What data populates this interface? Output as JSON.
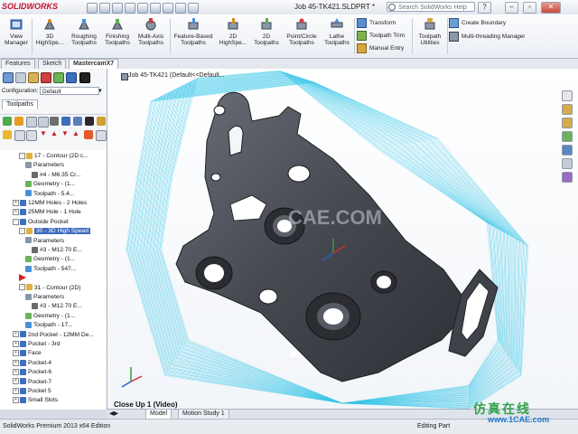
{
  "app": {
    "logo": "SOLIDWORKS",
    "document_title": "Job 45-TK421.SLDPRT *",
    "search_placeholder": "Search SolidWorks Help"
  },
  "command_manager": {
    "large_buttons": [
      {
        "label": "View\nManager",
        "icon": "view-manager-icon"
      },
      {
        "label": "3D\nHighSpe...",
        "icon": "3d-highspeed-icon"
      },
      {
        "label": "Roughing\nToolpaths",
        "icon": "roughing-toolpaths-icon"
      },
      {
        "label": "Finishing\nToolpaths",
        "icon": "finishing-toolpaths-icon"
      },
      {
        "label": "Multi-Axis\nToolpaths",
        "icon": "multi-axis-toolpaths-icon"
      },
      {
        "label": "Feature-Based\nToolpaths",
        "icon": "feature-based-toolpaths-icon"
      },
      {
        "label": "2D\nHighSpe...",
        "icon": "2d-highspeed-icon"
      },
      {
        "label": "2D\nToolpaths",
        "icon": "2d-toolpaths-icon"
      },
      {
        "label": "Point/Circle\nToolpaths",
        "icon": "point-circle-toolpaths-icon"
      },
      {
        "label": "Lathe\nToolpaths",
        "icon": "lathe-toolpaths-icon"
      }
    ],
    "small_buttons_col1": [
      "Transform",
      "Toolpath Trim",
      "Manual Entry"
    ],
    "utilities_label": "Toolpath\nUtilities",
    "small_buttons_col2": [
      "Create Boundary",
      "Multi-threading Manager"
    ]
  },
  "panel_tabs": [
    "Features",
    "Sketch",
    "MastercamX7"
  ],
  "left_panel": {
    "configuration_label": "Configuration:",
    "configuration_value": "Default",
    "toolpaths_tab": "Toolpaths",
    "tree": [
      {
        "indent": 3,
        "pm": "-",
        "icon": "folder",
        "text": "17 - Contour (2D c..."
      },
      {
        "indent": 4,
        "pm": "",
        "icon": "params",
        "text": "Parameters"
      },
      {
        "indent": 5,
        "pm": "",
        "icon": "tool",
        "text": "#4 - M6.35 Cr..."
      },
      {
        "indent": 4,
        "pm": "",
        "icon": "geometry",
        "text": "Geometry - (1..."
      },
      {
        "indent": 4,
        "pm": "",
        "icon": "toolpath",
        "text": "Toolpath - 5.4..."
      },
      {
        "indent": 2,
        "pm": "+",
        "icon": "op",
        "text": "12MM Holes - 2 Holes"
      },
      {
        "indent": 2,
        "pm": "+",
        "icon": "op",
        "text": "25MM Hole - 1 Hole"
      },
      {
        "indent": 2,
        "pm": "-",
        "icon": "op",
        "text": "Outside Pocket"
      },
      {
        "indent": 3,
        "pm": "-",
        "icon": "folder",
        "text": "30 - 3D High Speed",
        "selected": true
      },
      {
        "indent": 4,
        "pm": "",
        "icon": "params",
        "text": "Parameters"
      },
      {
        "indent": 5,
        "pm": "",
        "icon": "tool",
        "text": "#3 - M12.70 E..."
      },
      {
        "indent": 4,
        "pm": "",
        "icon": "geometry",
        "text": "Geometry - (1..."
      },
      {
        "indent": 4,
        "pm": "",
        "icon": "toolpath",
        "text": "Toolpath - 547..."
      },
      {
        "indent": 3,
        "pm": "",
        "icon": "arrow",
        "text": ""
      },
      {
        "indent": 3,
        "pm": "-",
        "icon": "folder",
        "text": "31 - Contour (2D)"
      },
      {
        "indent": 4,
        "pm": "",
        "icon": "params",
        "text": "Parameters"
      },
      {
        "indent": 5,
        "pm": "",
        "icon": "tool",
        "text": "#3 - M12.70 E..."
      },
      {
        "indent": 4,
        "pm": "",
        "icon": "geometry",
        "text": "Geometry - (1..."
      },
      {
        "indent": 4,
        "pm": "",
        "icon": "toolpath",
        "text": "Toolpath - 17..."
      },
      {
        "indent": 2,
        "pm": "+",
        "icon": "op",
        "text": "2nd Pocket - 12MM De..."
      },
      {
        "indent": 2,
        "pm": "+",
        "icon": "op",
        "text": "Pocket - 3rd"
      },
      {
        "indent": 2,
        "pm": "+",
        "icon": "op",
        "text": "Face"
      },
      {
        "indent": 2,
        "pm": "+",
        "icon": "op",
        "text": "Pocket-4"
      },
      {
        "indent": 2,
        "pm": "+",
        "icon": "op",
        "text": "Pocket-6"
      },
      {
        "indent": 2,
        "pm": "+",
        "icon": "op",
        "text": "Pocket-7"
      },
      {
        "indent": 2,
        "pm": "+",
        "icon": "op",
        "text": "Pocket 5"
      },
      {
        "indent": 2,
        "pm": "+",
        "icon": "op",
        "text": "Small Slots"
      }
    ]
  },
  "viewport": {
    "title": "Job 45-TK421 (Default<<Default...",
    "caption": "Close Up 1 (Video)",
    "watermark_center": "CAE.COM"
  },
  "bottom_tabs": [
    "Model",
    "Motion Study 1"
  ],
  "status": {
    "left": "SolidWorks Premium 2013 x64 Edition",
    "right": "Editing Part"
  },
  "site_watermark": {
    "chinese": "仿真在线",
    "url": "www.1CAE.com"
  },
  "colors": {
    "toolpath": "#35c6e8",
    "part": "#4a4d55",
    "selection": "#3d6bbf",
    "accent_red": "#c8102e"
  }
}
